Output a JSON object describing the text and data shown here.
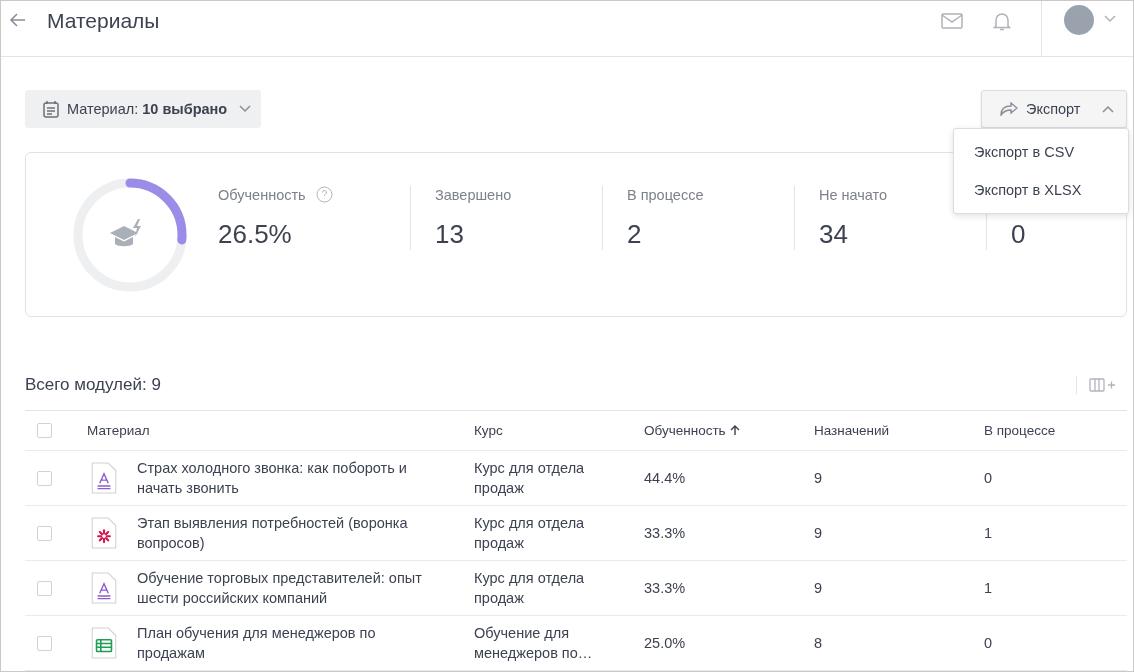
{
  "header": {
    "title": "Материалы"
  },
  "filter": {
    "label": "Материал: ",
    "value": "10 выбрано"
  },
  "export": {
    "label": "Экспорт",
    "expanded": true,
    "menu": [
      "Экспорт в CSV",
      "Экспорт в XLSX"
    ]
  },
  "summary": {
    "level": 0.265,
    "stats": [
      {
        "label": "Обученность",
        "value": "26.5%",
        "help": true
      },
      {
        "label": "Завершено",
        "value": "13"
      },
      {
        "label": "В процессе",
        "value": "2"
      },
      {
        "label": "Не начато",
        "value": "34"
      },
      {
        "value": "0"
      }
    ]
  },
  "table": {
    "title": "Всего модулей: 9",
    "select_all": {
      "checked": false
    },
    "columns": [
      {
        "label": "Материал"
      },
      {
        "label": "Курс"
      },
      {
        "label": "Обученность",
        "sorted": true
      },
      {
        "label": "Назначений"
      },
      {
        "label": "В процессе"
      }
    ],
    "rows": [
      {
        "checked": false,
        "kind": "text",
        "material": "Страх холодного звонка: как побороть и начать звонить",
        "course": "Курс для отдела продаж",
        "progress": "44.4%",
        "assigned": "9",
        "in_progress": "0"
      },
      {
        "checked": false,
        "kind": "interactive",
        "material": "Этап выявления потребностей (воронка вопросов)",
        "course": "Курс для отдела продаж",
        "progress": "33.3%",
        "assigned": "9",
        "in_progress": "1"
      },
      {
        "checked": false,
        "kind": "text",
        "material": "Обучение торговых представителей: опыт шести российских компаний",
        "course": "Курс для отдела продаж",
        "progress": "33.3%",
        "assigned": "9",
        "in_progress": "1"
      },
      {
        "checked": false,
        "kind": "sheet",
        "material": "План обучения для менеджеров по продажам",
        "course": "Обучение для менеджеров по…",
        "progress": "25.0%",
        "assigned": "8",
        "in_progress": "0"
      }
    ]
  }
}
